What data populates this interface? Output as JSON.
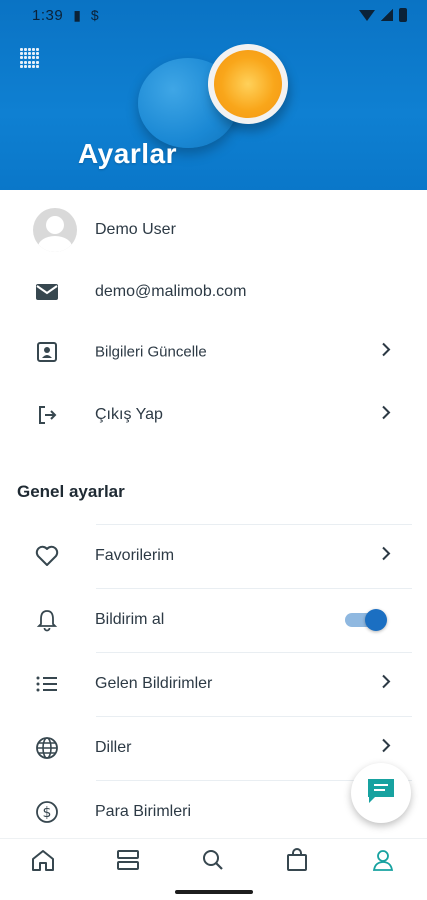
{
  "status_bar": {
    "time": "1:39"
  },
  "header": {
    "title": "Ayarlar"
  },
  "profile": {
    "name": "Demo User",
    "email": "demo@malimob.com",
    "update_info": "Bilgileri Güncelle",
    "logout": "Çıkış Yap"
  },
  "general": {
    "section_title": "Genel ayarlar",
    "items": [
      {
        "label": "Favorilerim",
        "icon": "heart-icon"
      },
      {
        "label": "Bildirim al",
        "icon": "bell-icon",
        "toggle": true
      },
      {
        "label": "Gelen Bildirimler",
        "icon": "list-icon"
      },
      {
        "label": "Diller",
        "icon": "globe-icon"
      },
      {
        "label": "Para Birimleri",
        "icon": "dollar-circle-icon"
      }
    ]
  },
  "bottom_nav": [
    {
      "icon": "home-icon"
    },
    {
      "icon": "categories-icon"
    },
    {
      "icon": "search-icon"
    },
    {
      "icon": "bag-icon"
    },
    {
      "icon": "profile-icon",
      "active": true
    }
  ],
  "colors": {
    "accent": "#17a2a0",
    "header_blue": "#0f80d2",
    "toggle": "#1b6fc2"
  }
}
